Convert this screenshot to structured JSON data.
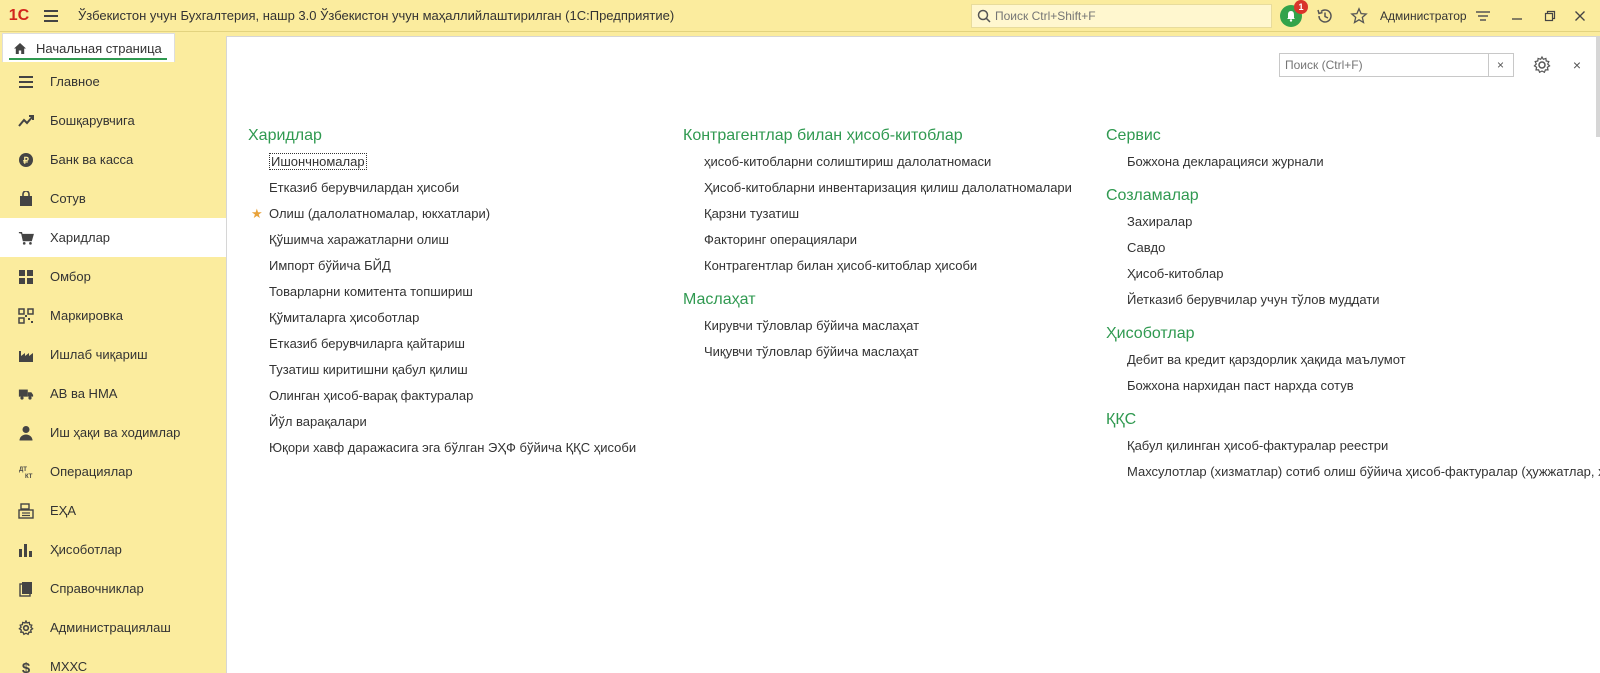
{
  "titlebar": {
    "logo": "1С",
    "title": "Ўзбекистон учун Бухгалтерия, нашр 3.0 Ўзбекистон учун маҳаллийлаштирилган  (1С:Предприятие)",
    "search_placeholder": "Поиск Ctrl+Shift+F",
    "notification_count": "1",
    "user": "Администратор",
    "accent_color": "#fbec9e"
  },
  "tabs": {
    "home_label": "Начальная страница"
  },
  "sidebar": {
    "items": [
      {
        "label": "Главное",
        "icon": "list-icon"
      },
      {
        "label": "Бошқарувчига",
        "icon": "trend-icon"
      },
      {
        "label": "Банк ва касса",
        "icon": "coin-icon"
      },
      {
        "label": "Сотув",
        "icon": "bag-icon"
      },
      {
        "label": "Харидлар",
        "icon": "cart-icon"
      },
      {
        "label": "Омбор",
        "icon": "grid-icon"
      },
      {
        "label": "Маркировка",
        "icon": "qr-icon"
      },
      {
        "label": "Ишлаб чиқариш",
        "icon": "factory-icon"
      },
      {
        "label": "АВ ва НМА",
        "icon": "truck-icon"
      },
      {
        "label": "Иш ҳақи ва ходимлар",
        "icon": "person-icon"
      },
      {
        "label": "Операциялар",
        "icon": "dt-kt-icon"
      },
      {
        "label": "ЕҲА",
        "icon": "cashregister-icon"
      },
      {
        "label": "Ҳисоботлар",
        "icon": "barchart-icon"
      },
      {
        "label": "Справочниклар",
        "icon": "book-icon"
      },
      {
        "label": "Администрациялаш",
        "icon": "gear-icon"
      },
      {
        "label": "МХХС",
        "icon": "dollar-icon"
      }
    ],
    "active_index": 4
  },
  "form": {
    "search_placeholder": "Поиск (Ctrl+F)",
    "clear_symbol": "×",
    "close_symbol": "×"
  },
  "columns": [
    {
      "groups": [
        {
          "title": "Харидлар",
          "links": [
            "Ишончномалар",
            "Етказиб берувчилардан ҳисоби",
            "Олиш (далолатномалар, юкхатлари)",
            "Қўшимча харажатларни олиш",
            "Импорт бўйича БЙД",
            "Товарларни комитента топшириш",
            "Қўмиталарга ҳисоботлар",
            "Етказиб берувчиларга қайтариш",
            "Тузатиш киритишни қабул қилиш",
            "Олинган ҳисоб-варақ фактуралар",
            "Йўл варақалари",
            "Юқори хавф даражасига эга бўлган ЭҲФ бўйича ҚҚС ҳисоби"
          ]
        }
      ]
    },
    {
      "groups": [
        {
          "title": "Контрагентлар билан ҳисоб-китоблар",
          "links": [
            "ҳисоб-китобларни солиштириш далолатномаси",
            "Ҳисоб-китобларни инвентаризация қилиш далолатномалари",
            "Қарзни тузатиш",
            "Факторинг операциялари",
            "Контрагентлар билан ҳисоб-китоблар ҳисоби"
          ]
        },
        {
          "title": "Маслаҳат",
          "links": [
            "Кирувчи тўловлар бўйича маслаҳат",
            "Чиқувчи тўловлар бўйича маслаҳат"
          ]
        }
      ]
    },
    {
      "groups": [
        {
          "title": "Сервис",
          "links": [
            "Божхона декларацияси журнали"
          ]
        },
        {
          "title": "Созламалар",
          "links": [
            "Захиралар",
            "Савдо",
            "Ҳисоб-китоблар",
            "Йетказиб берувчилар учун тўлов муддати"
          ]
        },
        {
          "title": "Ҳисоботлар",
          "links": [
            "Дебит ва кредит қарздорлик ҳақида маълумот",
            "Божхона нархидан паст нархда сотув"
          ]
        },
        {
          "title": "ҚҚС",
          "links": [
            "Қабул қилинган ҳисоб-фактуралар реестри",
            "Махсулотлар (хизматлар) сотиб олиш бўйича ҳисоб-фактуралар (ҳужжатлар, хатлар)"
          ]
        }
      ]
    }
  ]
}
